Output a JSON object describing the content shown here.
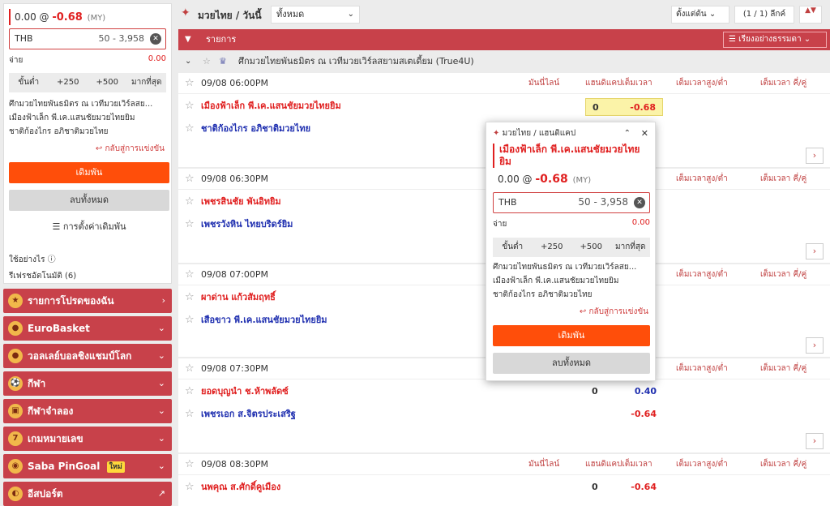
{
  "slip": {
    "line_value": "0.00",
    "odds": "-0.68",
    "odds_type": "(MY)",
    "currency": "THB",
    "range": "50 - 3,958",
    "pay_label": "จ่าย",
    "pay_value": "0.00",
    "quick": [
      "ขั้นต่ำ",
      "+250",
      "+500",
      "มากที่สุด"
    ],
    "desc": [
      "ศึกมวยไทยพันธมิตร ณ เวทีมวยเวิร์ลสย...",
      "เมืองฟ้าเล็ก พี.เค.แสนชัยมวยไทยยิม",
      "ชาติก้องไกร อภิชาติมวยไทย"
    ],
    "back": "กลับสู่การแข่งขัน",
    "bet": "เดิมพัน",
    "clear": "ลบทั้งหมด",
    "settings": "การตั้งค่าเดิมพัน",
    "howto": "ใช้อย่างไร",
    "refer": "รีเฟรชอัตโนมัติ (6)"
  },
  "menu": [
    {
      "label": "รายการโปรดของฉัน",
      "icon": "star-icon",
      "arrow": "›"
    },
    {
      "label": "EuroBasket",
      "icon": "basketball-icon",
      "arrow": "⌄"
    },
    {
      "label": "วอลเลย์บอลชิงแชมป์โลก",
      "icon": "volleyball-icon",
      "arrow": "⌄"
    },
    {
      "label": "กีฬา",
      "icon": "soccer-icon",
      "arrow": "⌄"
    },
    {
      "label": "กีฬาจำลอง",
      "icon": "virtual-sports-icon",
      "arrow": "⌄"
    },
    {
      "label": "เกมหมายเลข",
      "icon": "number-game-icon",
      "arrow": "⌄"
    },
    {
      "label": "Saba PinGoal",
      "icon": "pingoal-icon",
      "arrow": "⌄",
      "badge": "ใหม่"
    },
    {
      "label": "อีสปอร์ต",
      "icon": "esports-icon",
      "arrow": "↗"
    }
  ],
  "topbar": {
    "title": "มวยไทย / วันนี้",
    "filter": "ทั้งหมด",
    "sort": "ตั้งแต่ต้น",
    "page": "(1 / 1) ลีกค์",
    "updown": "▲▼"
  },
  "list_header": {
    "label": "รายการ",
    "sort": "เรียงอย่างธรรมดา"
  },
  "league": "ศึกมวยไทยพันธมิตร ณ เวทีมวยเวิร์ลสยามสเตเดี้ยม (True4U)",
  "columns": [
    "มันนี่ไลน์",
    "แฮนดิแคปเต็มเวลา",
    "เต็มเวลาสูง/ต่ำ",
    "เต็มเวลา คี่/คู่"
  ],
  "matches": [
    {
      "time": "09/08 06:00PM",
      "home": "เมืองฟ้าเล็ก พี.เค.แสนชัยมวยไทยยิม",
      "away": "ชาติก้องไกร อภิชาติมวยไทย",
      "hdp": "0",
      "home_odds": "-0.68",
      "away_odds": ""
    },
    {
      "time": "09/08 06:30PM",
      "home": "เพชรสินชัย พันอิทยิม",
      "away": "เพชรวังหิน ไทยบริดร์ยิม",
      "hdp": "",
      "home_odds": "",
      "away_odds": ""
    },
    {
      "time": "09/08 07:00PM",
      "home": "ผาด่าน แก้วสัมฤทธิ์",
      "away": "เสือขาว พี.เค.แสนชัยมวยไทยยิม",
      "hdp": "",
      "home_odds": "",
      "away_odds": ""
    },
    {
      "time": "09/08 07:30PM",
      "home": "ยอดบุญนำ ช.ห้าพลัดซ์",
      "away": "เพชรเอก ส.จิตรประเสริฐ",
      "hdp": "0",
      "home_odds": "0.40",
      "away_odds": "-0.64"
    },
    {
      "time": "09/08 08:30PM",
      "home": "นพคุณ ส.ศักดิ์คูเมือง",
      "away": "",
      "hdp": "0",
      "home_odds": "-0.64",
      "away_odds": ""
    }
  ],
  "popup": {
    "header": "มวยไทย / แฮนดิแคป",
    "team": "เมืองฟ้าเล็ก พี.เค.แสนชัยมวยไทยยิม",
    "line_value": "0.00 @",
    "odds": "-0.68",
    "odds_type": "(MY)",
    "currency": "THB",
    "range": "50 - 3,958",
    "pay_label": "จ่าย",
    "pay_value": "0.00",
    "quick": [
      "ขั้นต่ำ",
      "+250",
      "+500",
      "มากที่สุด"
    ],
    "desc": [
      "ศึกมวยไทยพันธมิตร ณ เวทีมวยเวิร์ลสย...",
      "เมืองฟ้าเล็ก พี.เค.แสนชัยมวยไทยยิม",
      "ชาติก้องไกร อภิชาติมวยไทย"
    ],
    "back": "กลับสู่การแข่งขัน",
    "bet": "เดิมพัน",
    "clear": "ลบทั้งหมด"
  },
  "colors": {
    "accent": "#c8414a",
    "bet": "#ff4e0a",
    "home": "#e02020",
    "away": "#2030b0"
  }
}
